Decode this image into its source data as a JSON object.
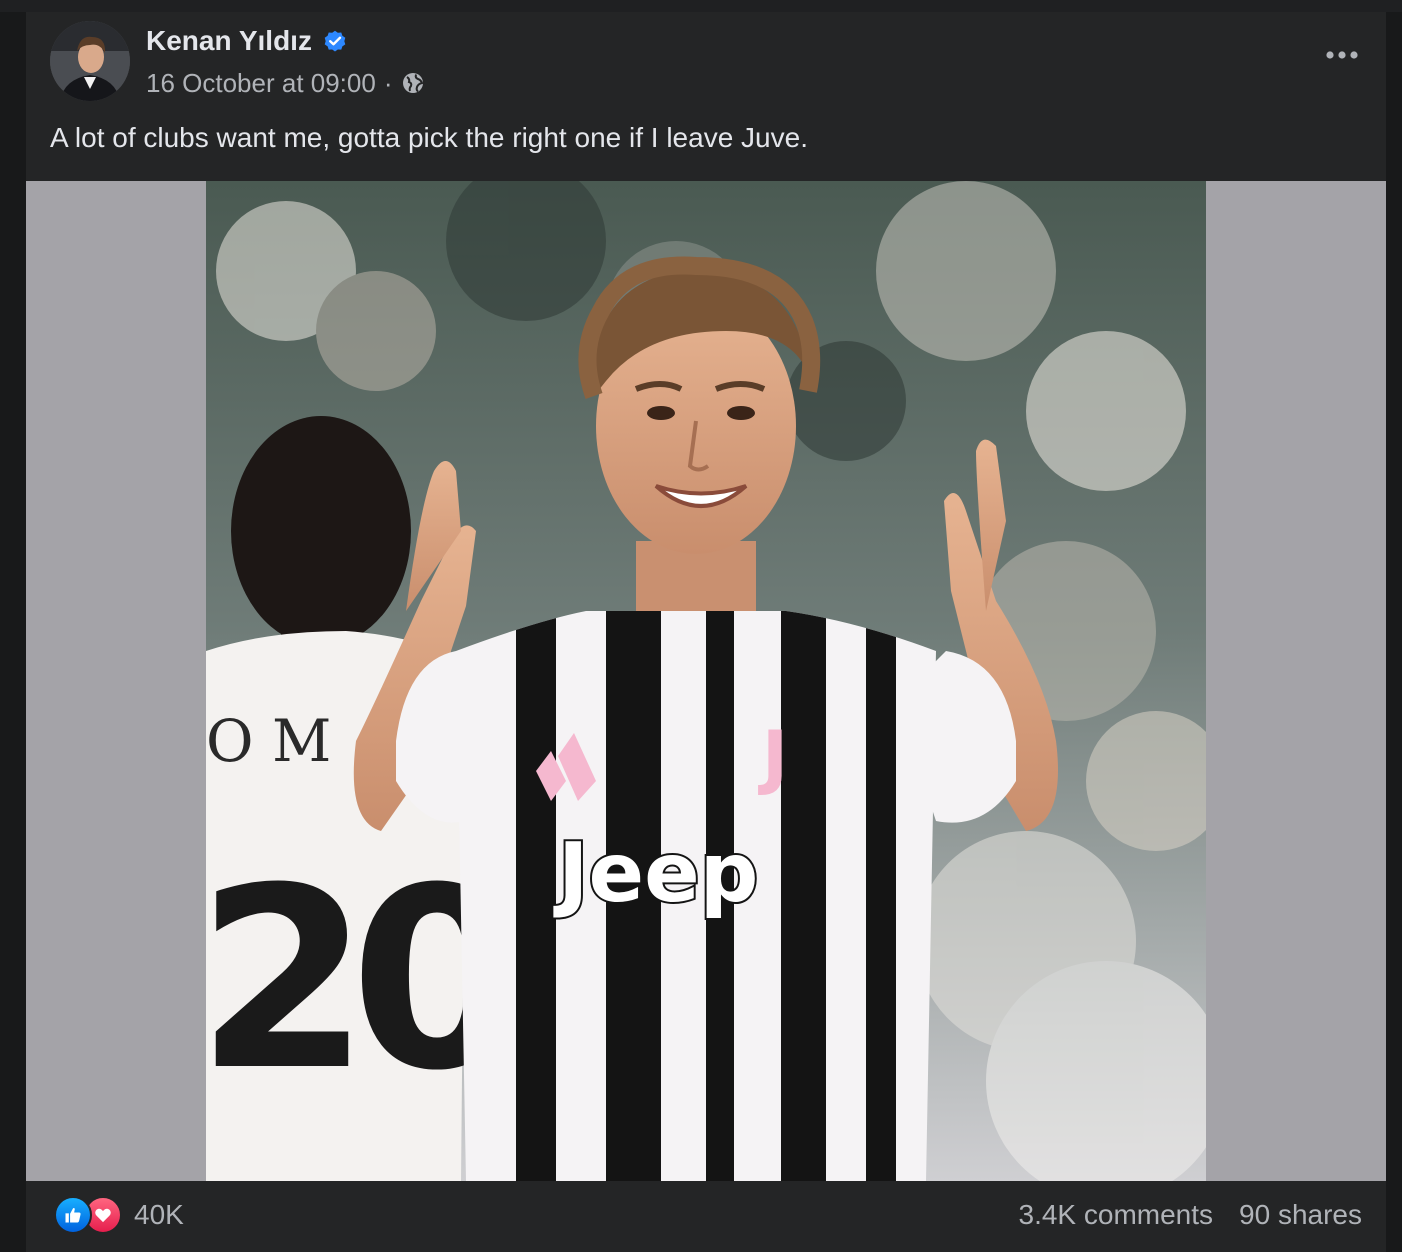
{
  "post": {
    "author": {
      "name": "Kenan Yıldız",
      "verified": true,
      "avatar_icon": "profile-photo"
    },
    "timestamp": "16 October at 09:00",
    "separator": "·",
    "audience_icon": "globe-icon",
    "more_icon": "more-dots-icon",
    "caption": "A lot of clubs want me, gotta pick the right one if I leave Juve.",
    "photo": {
      "shirt_sponsor": "Jeep",
      "teammate_number": "20",
      "teammate_name_fragment": "O M"
    }
  },
  "footer": {
    "reactions": [
      "like",
      "love"
    ],
    "reaction_count": "40K",
    "comments": "3.4K comments",
    "shares": "90 shares"
  },
  "colors": {
    "background": "#18191a",
    "card": "#242526",
    "primary_text": "#e4e6eb",
    "secondary_text": "#b0b3b8",
    "verified_blue": "#2d88ff",
    "like_blue": "#1877f2",
    "love_red": "#f33e58",
    "media_letterbox": "#a4a3a8"
  }
}
